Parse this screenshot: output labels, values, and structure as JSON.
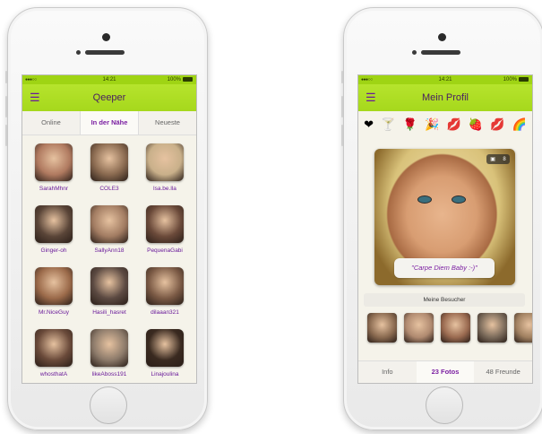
{
  "left_screen": {
    "status": {
      "time": "14:21",
      "battery": "100%"
    },
    "nav_title": "Qeeper",
    "segments": [
      "Online",
      "In der Nähe",
      "Neueste"
    ],
    "active_segment": 1,
    "users": [
      {
        "name": "SarahMhnr",
        "color": "#b07a60"
      },
      {
        "name": "COLE3",
        "color": "#8a6a50"
      },
      {
        "name": "lsa.be.lla",
        "color": "#c9b08a"
      },
      {
        "name": "Ginger-oh",
        "color": "#5a4538"
      },
      {
        "name": "SallyAnn18",
        "color": "#a27c62"
      },
      {
        "name": "PequenaGabi",
        "color": "#6b4a3a"
      },
      {
        "name": "Mr.NiceGuy",
        "color": "#9b6a4a"
      },
      {
        "name": "Hasili_hasret",
        "color": "#5c4a42"
      },
      {
        "name": "dilaaan321",
        "color": "#7b5a45"
      },
      {
        "name": "whosthatA",
        "color": "#6a4a3a"
      },
      {
        "name": "likeAboss191",
        "color": "#8c7a6a"
      },
      {
        "name": "Linajoulina",
        "color": "#3a2a20"
      }
    ]
  },
  "right_screen": {
    "status": {
      "time": "14:21",
      "battery": "100%"
    },
    "nav_title": "Mein Profil",
    "emojis": [
      "❤",
      "🍸",
      "🌹",
      "🎉",
      "💋",
      "🍓",
      "💋",
      "🌈"
    ],
    "photo_counter": "8",
    "quote": "\"Carpe Diem Baby :-)\"",
    "visitors_label": "Meine Besucher",
    "visitor_colors": [
      "#8a6a50",
      "#b08a70",
      "#9a6a50",
      "#7a6a5a",
      "#a08060"
    ],
    "tabs": [
      "Info",
      "23 Fotos",
      "48 Freunde"
    ],
    "active_tab": 1
  },
  "colors": {
    "accent_green": "#a6d81c",
    "accent_purple": "#7b1fa2"
  }
}
